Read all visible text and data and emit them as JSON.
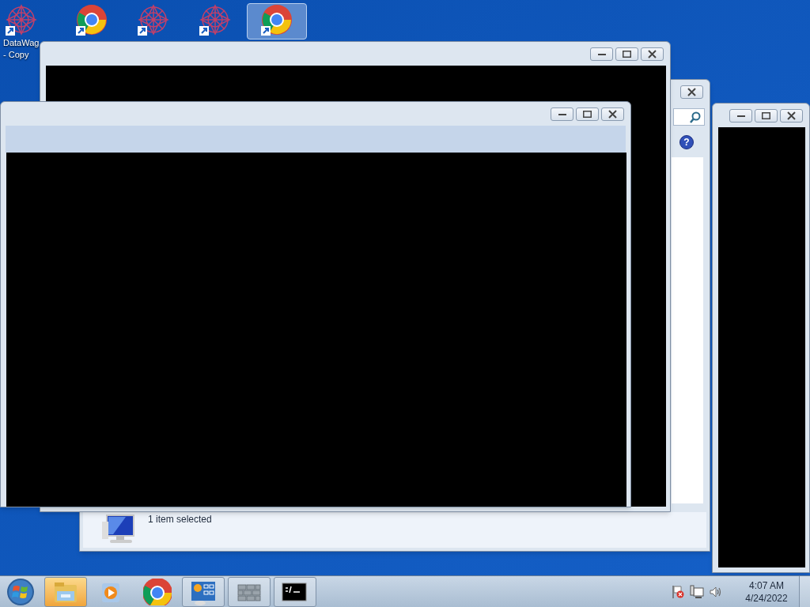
{
  "desktop_icons": [
    {
      "kind": "web",
      "label": [
        "DataWag",
        "- Copy"
      ],
      "selected": false
    },
    {
      "kind": "chrome",
      "selected": false
    },
    {
      "kind": "web",
      "selected": false
    },
    {
      "kind": "web",
      "selected": false
    },
    {
      "kind": "chrome",
      "selected": true
    }
  ],
  "windows": [
    {
      "kind": "plain"
    },
    {
      "kind": "explorer",
      "help": "?",
      "status": "1 item selected"
    },
    {
      "kind": "plain"
    },
    {
      "kind": "tool"
    }
  ],
  "taskbar": {
    "items": [
      {
        "kind": "explorer",
        "running": true,
        "highlighted": true
      },
      {
        "kind": "media",
        "running": false,
        "highlighted": false
      },
      {
        "kind": "chrome",
        "running": false,
        "highlighted": false
      },
      {
        "kind": "control",
        "running": true,
        "highlighted": false
      },
      {
        "kind": "firewall",
        "running": true,
        "highlighted": false
      },
      {
        "kind": "cmd",
        "running": true,
        "highlighted": false
      }
    ],
    "tray": {
      "time": "4:07 AM",
      "date": "4/24/2022"
    }
  }
}
